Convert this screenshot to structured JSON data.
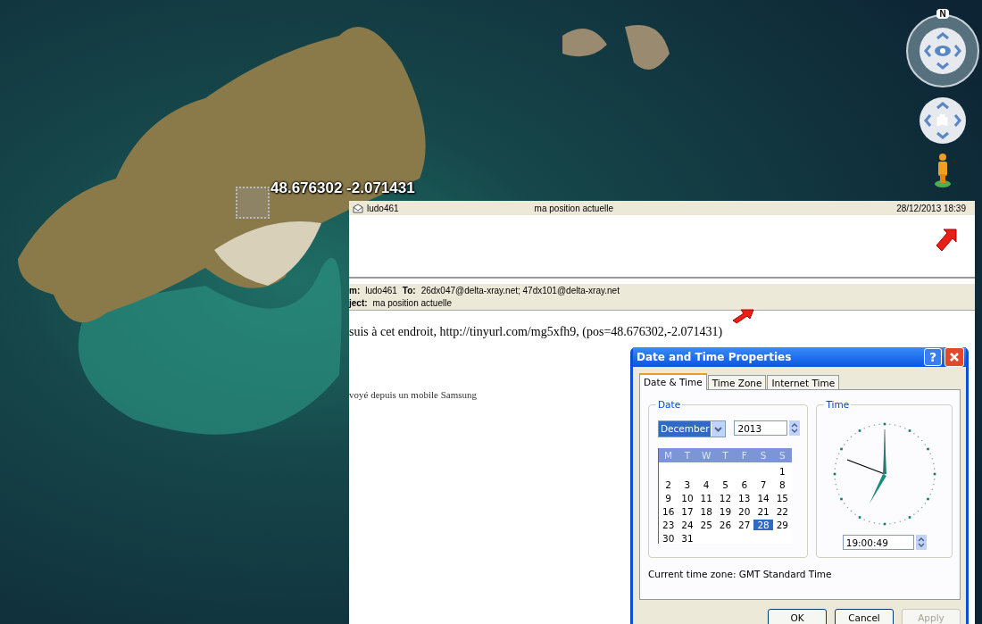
{
  "map": {
    "coordinates_label": "48.676302 -2.071431"
  },
  "navigation": {
    "compass_label": "N"
  },
  "mail": {
    "list_row": {
      "sender": "ludo461",
      "subject": "ma position actuelle",
      "date": "28/12/2013 18:39"
    },
    "header": {
      "from_label": "m:",
      "from": "ludo461",
      "to_label": "To:",
      "to": "26dx047@delta-xray.net; 47dx101@delta-xray.net",
      "subject_label": "ject:",
      "subject": "ma position actuelle"
    },
    "body": [
      "suis à cet endroit, http://tinyurl.com/mg5xfh9, (pos=48.676302,-2.071431)",
      "voyé depuis un mobile Samsung"
    ]
  },
  "dialog": {
    "title": "Date and Time Properties",
    "help_label": "?",
    "tabs": [
      {
        "label": "Date & Time",
        "selected": true
      },
      {
        "label": "Time Zone",
        "selected": false
      },
      {
        "label": "Internet Time",
        "selected": false
      }
    ],
    "date_group": {
      "label": "Date",
      "month": "December",
      "year": "2013",
      "weekdays": [
        "M",
        "T",
        "W",
        "T",
        "F",
        "S",
        "S"
      ],
      "weeks": [
        [
          {
            "label": "1",
            "selected": false
          }
        ],
        [
          {
            "label": "2",
            "selected": false
          },
          {
            "label": "3",
            "selected": false
          },
          {
            "label": "4",
            "selected": false
          },
          {
            "label": "5",
            "selected": false
          },
          {
            "label": "6",
            "selected": false
          },
          {
            "label": "7",
            "selected": false
          },
          {
            "label": "8",
            "selected": false
          }
        ],
        [
          {
            "label": "9",
            "selected": false
          },
          {
            "label": "10",
            "selected": false
          },
          {
            "label": "11",
            "selected": false
          },
          {
            "label": "12",
            "selected": false
          },
          {
            "label": "13",
            "selected": false
          },
          {
            "label": "14",
            "selected": false
          },
          {
            "label": "15",
            "selected": false
          }
        ],
        [
          {
            "label": "16",
            "selected": false
          },
          {
            "label": "17",
            "selected": false
          },
          {
            "label": "18",
            "selected": false
          },
          {
            "label": "19",
            "selected": false
          },
          {
            "label": "20",
            "selected": false
          },
          {
            "label": "21",
            "selected": false
          },
          {
            "label": "22",
            "selected": false
          }
        ],
        [
          {
            "label": "23",
            "selected": false
          },
          {
            "label": "24",
            "selected": false
          },
          {
            "label": "25",
            "selected": false
          },
          {
            "label": "26",
            "selected": false
          },
          {
            "label": "27",
            "selected": false
          },
          {
            "label": "28",
            "selected": true
          },
          {
            "label": "29",
            "selected": false
          }
        ],
        [
          {
            "label": "30",
            "selected": false
          },
          {
            "label": "31",
            "selected": false
          }
        ]
      ]
    },
    "time_group": {
      "label": "Time",
      "time": "19:00:49"
    },
    "timezone_text": "Current time zone:  GMT Standard Time",
    "buttons": [
      {
        "label": "OK",
        "disabled": false
      },
      {
        "label": "Cancel",
        "disabled": false
      },
      {
        "label": "Apply",
        "disabled": true
      }
    ]
  }
}
